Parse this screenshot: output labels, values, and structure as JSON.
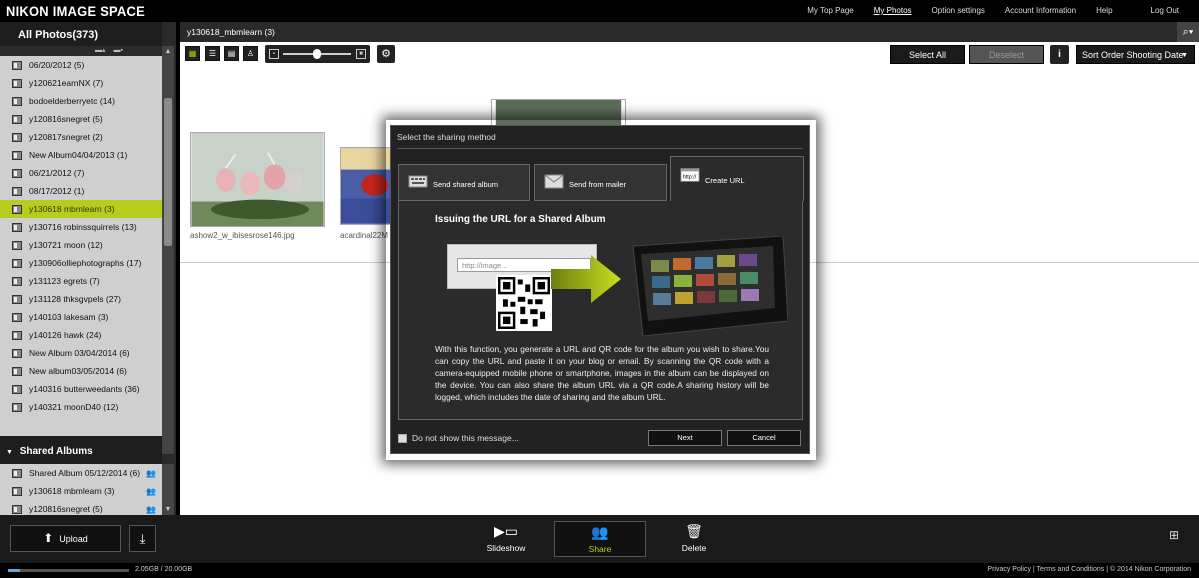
{
  "brand": "NIKON IMAGE SPACE",
  "topnav": {
    "items": [
      "My Top Page",
      "My Photos",
      "Option settings",
      "Account Information",
      "Help"
    ],
    "active": "My Photos",
    "logout": "Log Out"
  },
  "sidebar": {
    "all_photos": "All Photos(373)",
    "albums": [
      "06/20/2012 (5)",
      "y120621earnNX (7)",
      "bodoelderberryetc (14)",
      "y120816snegret (5)",
      "y120817snegret (2)",
      "New Album04/04/2013 (1)",
      "06/21/2012 (7)",
      "08/17/2012 (1)",
      "y130618 mbmlearn (3)",
      "y130716 robinssquirrels (13)",
      "y130721 moon (12)",
      "y130906olliephotographs (17)",
      "y131123 egrets (7)",
      "y131128 thksgvpels (27)",
      "y140103 lakesam (3)",
      "y140126 hawk (24)",
      "New Album 03/04/2014 (6)",
      "New album03/05/2014 (6)",
      "y140316 butterweedants (36)",
      "y140321 moonD40 (12)"
    ],
    "selected_album": "y130618 mbmlearn (3)",
    "shared_header": "Shared Albums",
    "shared_albums": [
      "Shared Album 05/12/2014 (6)",
      "y130618 mbmlearn (3)",
      "y120816snegret (5)"
    ]
  },
  "main": {
    "path": "y130618_mbmlearn (3)",
    "select_all": "Select All",
    "deselect": "Deselect",
    "sort": "Sort Order Shooting Date",
    "thumbnails": [
      {
        "caption": "ashow2_w_ibisesrose146.jpg"
      },
      {
        "caption": "acardinal22M"
      }
    ]
  },
  "dialog": {
    "title": "Select the sharing method",
    "tabs": [
      "Send shared album",
      "Send from mailer",
      "Create URL"
    ],
    "active_tab": "Create URL",
    "heading": "Issuing the URL for a Shared Album",
    "url_placeholder": "http://image...",
    "body": "With this function, you generate a URL and QR code for the album you wish to share.You can copy the URL and paste it on your blog or email. By scanning the QR code with a camera-equipped mobile phone or smartphone, images in the album can be displayed on the device. You can also share the album URL via a QR code.A sharing history will be logged, which includes the date of sharing and the album URL.",
    "checkbox_label": "Do not show this message...",
    "next": "Next",
    "cancel": "Cancel"
  },
  "bottom": {
    "upload": "Upload",
    "actions": [
      "Slideshow",
      "Share",
      "Delete"
    ],
    "active_action": "Share"
  },
  "footer": {
    "storage": "2.05GB / 20.00GB",
    "storage_fraction": 0.1025,
    "links": "Privacy Policy  |  Terms and Conditions  |  © 2014  Nikon Corporation"
  },
  "colors": {
    "accent": "#b8cc1e",
    "selected_text": "#2b3b00"
  }
}
